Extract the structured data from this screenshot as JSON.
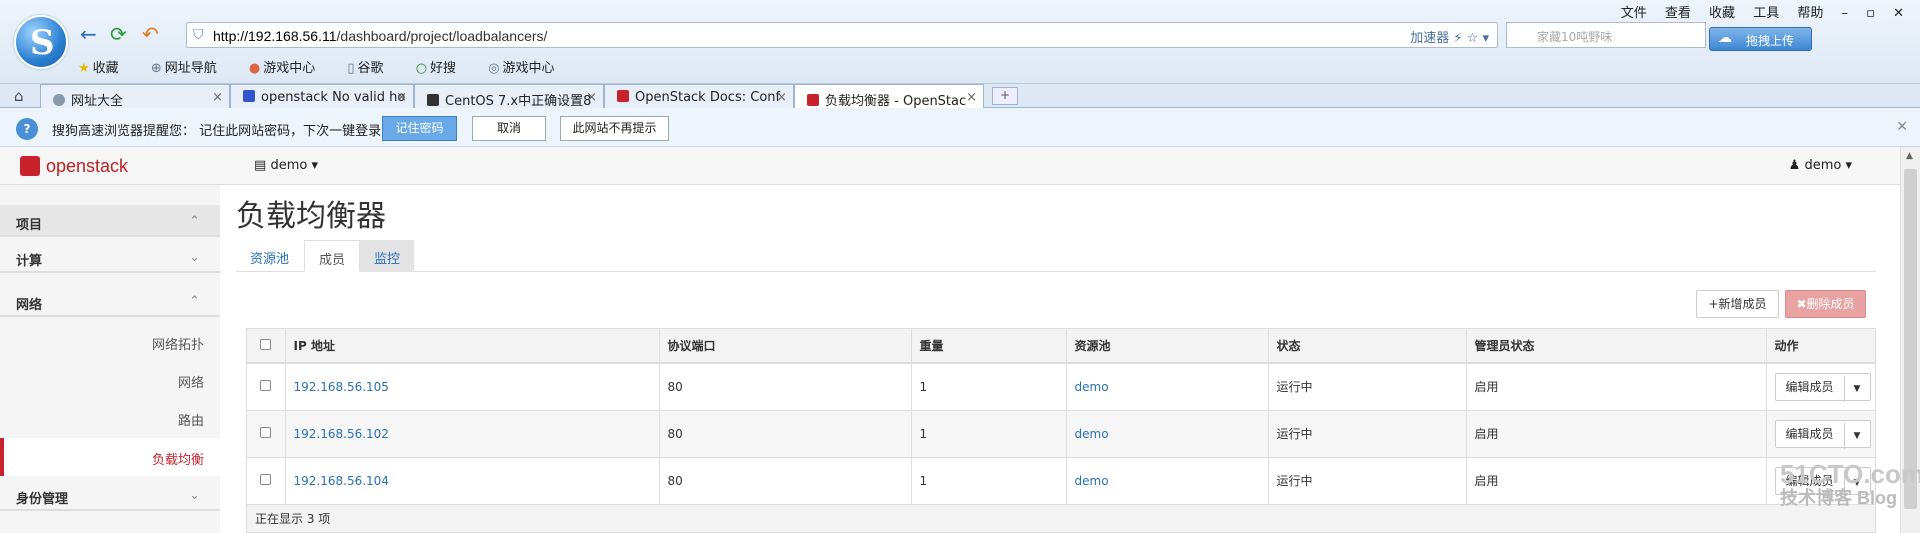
{
  "browser": {
    "url_host": "http://192.168.56.11",
    "url_path": "/dashboard/project/loadbalancers/",
    "accelerator": "加速器",
    "search_placeholder": "家藏10吨野味",
    "upload_label": "拖拽上传",
    "menu": [
      "文件",
      "查看",
      "收藏",
      "工具",
      "帮助"
    ],
    "favorites": [
      "收藏",
      "网址导航",
      "游戏中心",
      "谷歌",
      "好搜",
      "游戏中心"
    ],
    "tabs": [
      {
        "title": "网址大全",
        "color": "#8899aa"
      },
      {
        "title": "openstack No valid ho",
        "color": "#3355cc"
      },
      {
        "title": "CentOS 7.x中正确设置8",
        "color": "#333333"
      },
      {
        "title": "OpenStack Docs: Conf",
        "color": "#c8232c"
      },
      {
        "title": "负载均衡器 - OpenStac",
        "color": "#c8232c"
      }
    ],
    "notice": {
      "text": "搜狗高速浏览器提醒您： 记住此网站密码，下次一键登录！",
      "remember": "记住密码",
      "cancel": "取消",
      "never": "此网站不再提示"
    }
  },
  "header": {
    "brand": "openstack",
    "project": "demo",
    "user": "demo"
  },
  "sidebar": {
    "project": "项目",
    "compute": "计算",
    "network": "网络",
    "items": [
      "网络拓扑",
      "网络",
      "路由",
      "负载均衡"
    ],
    "identity": "身份管理"
  },
  "page": {
    "title": "负载均衡器",
    "tabs": [
      "资源池",
      "成员",
      "监控"
    ],
    "add_button": "+新增成员",
    "delete_button": "✖删除成员"
  },
  "table": {
    "columns": [
      "IP 地址",
      "协议端口",
      "重量",
      "资源池",
      "状态",
      "管理员状态",
      "动作"
    ],
    "rows": [
      {
        "ip": "192.168.56.105",
        "port": "80",
        "weight": "1",
        "pool": "demo",
        "status": "运行中",
        "admin": "启用",
        "action": "编辑成员"
      },
      {
        "ip": "192.168.56.102",
        "port": "80",
        "weight": "1",
        "pool": "demo",
        "status": "运行中",
        "admin": "启用",
        "action": "编辑成员"
      },
      {
        "ip": "192.168.56.104",
        "port": "80",
        "weight": "1",
        "pool": "demo",
        "status": "运行中",
        "admin": "启用",
        "action": "编辑成员"
      }
    ],
    "footer": "正在显示 3 项"
  },
  "watermark": {
    "brand": "51CTO.com",
    "sub": "技术博客 Blog"
  }
}
